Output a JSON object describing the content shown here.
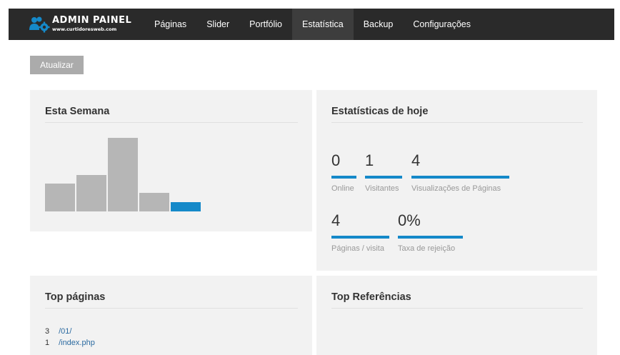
{
  "brand": {
    "title": "ADMIN PAINEL",
    "subtitle": "www.curtidoresweb.com",
    "icon": "users-gear-icon",
    "color": "#1589c9"
  },
  "nav": {
    "items": [
      {
        "label": "Páginas",
        "active": false
      },
      {
        "label": "Slider",
        "active": false
      },
      {
        "label": "Portfólio",
        "active": false
      },
      {
        "label": "Estatística",
        "active": true
      },
      {
        "label": "Backup",
        "active": false
      },
      {
        "label": "Configurações",
        "active": false
      }
    ]
  },
  "toolbar": {
    "refresh_label": "Atualizar"
  },
  "week": {
    "title": "Esta Semana",
    "chart_data": {
      "type": "bar",
      "values": [
        3,
        4,
        8,
        2,
        1
      ],
      "highlight_index": 4,
      "colors": {
        "default": "#b6b6b6",
        "highlight": "#1589c9"
      }
    }
  },
  "today": {
    "title": "Estatísticas de hoje",
    "stats": [
      {
        "value": "0",
        "label": "Online"
      },
      {
        "value": "1",
        "label": "Visitantes"
      },
      {
        "value": "4",
        "label": "Visualizações de Páginas"
      },
      {
        "value": "4",
        "label": "Páginas / visita"
      },
      {
        "value": "0%",
        "label": "Taxa de rejeição"
      }
    ]
  },
  "top_pages": {
    "title": "Top páginas",
    "items": [
      {
        "count": "3",
        "path": "/01/"
      },
      {
        "count": "1",
        "path": "/index.php"
      }
    ]
  },
  "top_refs": {
    "title": "Top Referências"
  }
}
